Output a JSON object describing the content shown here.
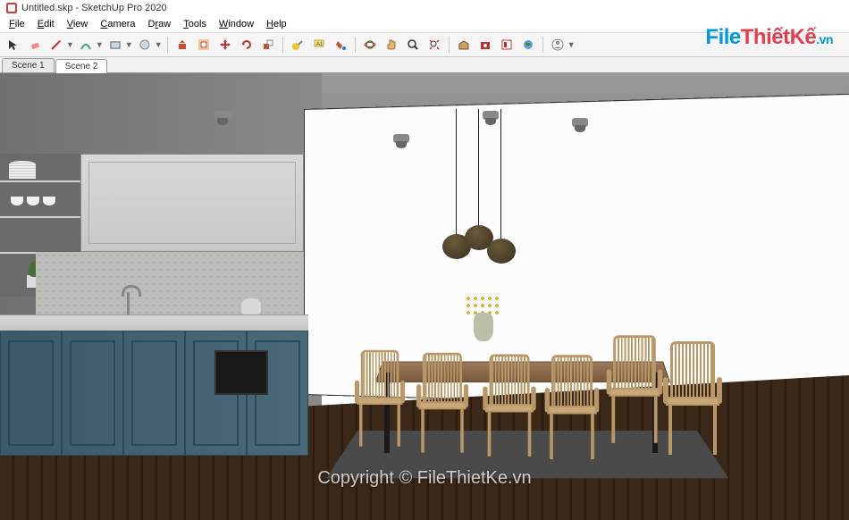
{
  "title": "Untitled.skp - SketchUp Pro 2020",
  "menus": {
    "file": "File",
    "edit": "Edit",
    "view": "View",
    "camera": "Camera",
    "draw": "Draw",
    "tools": "Tools",
    "window": "Window",
    "help": "Help"
  },
  "scenes": {
    "scene1": "Scene 1",
    "scene2": "Scene 2"
  },
  "watermark": {
    "logo_file": "File",
    "logo_thiet": "Thiết",
    "logo_ke": "Kế",
    "logo_vn": ".vn",
    "copyright": "Copyright © FileThietKe.vn"
  },
  "tools": {
    "select": "select",
    "eraser": "eraser",
    "line": "line",
    "arc": "arc",
    "rectangle": "rectangle",
    "circle": "circle",
    "pushpull": "push-pull",
    "offset": "offset",
    "move": "move",
    "rotate": "rotate",
    "scale": "scale",
    "tape": "tape-measure",
    "text": "text",
    "paint": "paint-bucket",
    "orbit": "orbit",
    "pan": "pan",
    "zoom": "zoom",
    "zoomextents": "zoom-extents",
    "warehouse": "3d-warehouse",
    "extensions": "extension-warehouse",
    "layout": "layout",
    "user": "user-account"
  }
}
